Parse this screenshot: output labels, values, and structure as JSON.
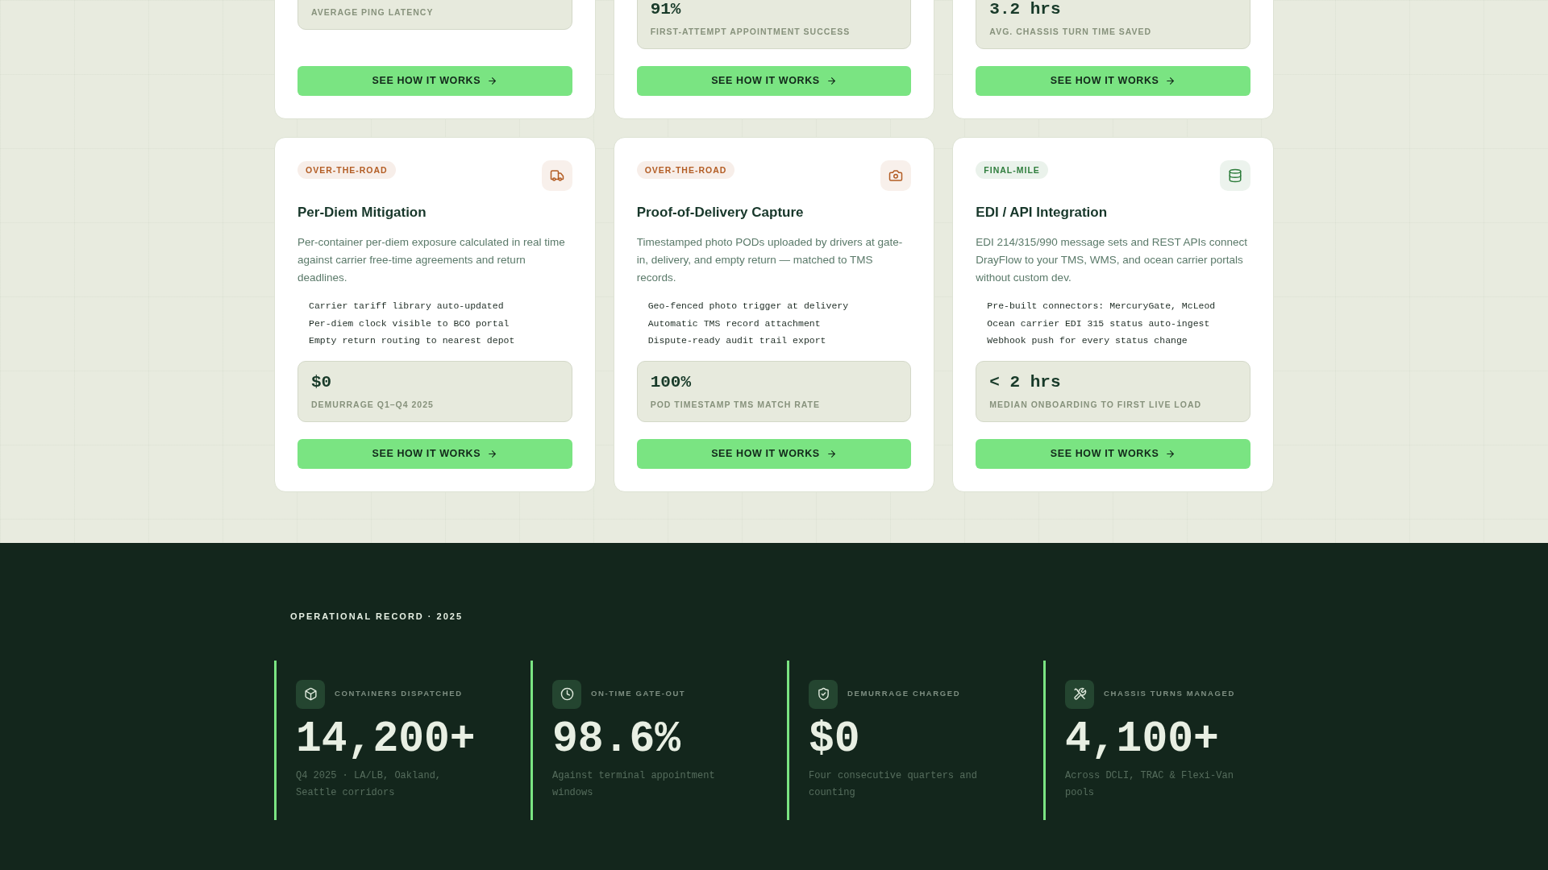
{
  "feature_cards": [
    {
      "metric": {
        "label": "AVERAGE PING LATENCY"
      },
      "button": "SEE HOW IT WORKS"
    },
    {
      "metric": {
        "value": "91%",
        "label": "FIRST-ATTEMPT APPOINTMENT SUCCESS"
      },
      "button": "SEE HOW IT WORKS"
    },
    {
      "metric": {
        "value": "3.2 hrs",
        "label": "AVG. CHASSIS TURN TIME SAVED"
      },
      "button": "SEE HOW IT WORKS"
    },
    {
      "tag": {
        "label": "OVER-THE-ROAD",
        "color": "#b35d24"
      },
      "title": "Per-Diem Mitigation",
      "description": "Per-container per-diem exposure calculated in real time against carrier free-time agreements and return deadlines.",
      "bullets": [
        "Carrier tariff library auto-updated",
        "Per-diem clock visible to BCO portal",
        "Empty return routing to nearest depot"
      ],
      "metric": {
        "value": "$0",
        "label": "DEMURRAGE Q1–Q4 2025"
      },
      "button": "SEE HOW IT WORKS"
    },
    {
      "tag": {
        "label": "OVER-THE-ROAD",
        "color": "#b35d24"
      },
      "title": "Proof-of-Delivery Capture",
      "description": "Timestamped photo PODs uploaded by drivers at gate-in, delivery, and empty return — matched to TMS records.",
      "bullets": [
        "Geo-fenced photo trigger at delivery",
        "Automatic TMS record attachment",
        "Dispute-ready audit trail export"
      ],
      "metric": {
        "value": "100%",
        "label": "POD TIMESTAMP TMS MATCH RATE"
      },
      "button": "SEE HOW IT WORKS"
    },
    {
      "tag": {
        "label": "FINAL-MILE",
        "color": "#2e7d3c"
      },
      "title": "EDI / API Integration",
      "description": "EDI 214/315/990 message sets and REST APIs connect DrayFlow to your TMS, WMS, and ocean carrier portals without custom dev.",
      "bullets": [
        "Pre-built connectors: MercuryGate, McLeod",
        "Ocean carrier EDI 315 status auto-ingest",
        "Webhook push for every status change"
      ],
      "metric": {
        "value": "< 2 hrs",
        "label": "MEDIAN ONBOARDING TO FIRST LIVE LOAD"
      },
      "button": "SEE HOW IT WORKS"
    }
  ],
  "operational_record": {
    "eyebrow": "OPERATIONAL RECORD · 2025",
    "stats": [
      {
        "label": "CONTAINERS DISPATCHED",
        "value": "14,200+",
        "note": "Q4 2025 · LA/LB, Oakland, Seattle corridors"
      },
      {
        "label": "ON-TIME GATE-OUT",
        "value": "98.6%",
        "note": "Against terminal appointment windows"
      },
      {
        "label": "DEMURRAGE CHARGED",
        "value": "$0",
        "note": "Four consecutive quarters and counting"
      },
      {
        "label": "CHASSIS TURNS MANAGED",
        "value": "4,100+",
        "note": "Across DCLI, TRAC & Flexi-Van pools"
      }
    ]
  }
}
